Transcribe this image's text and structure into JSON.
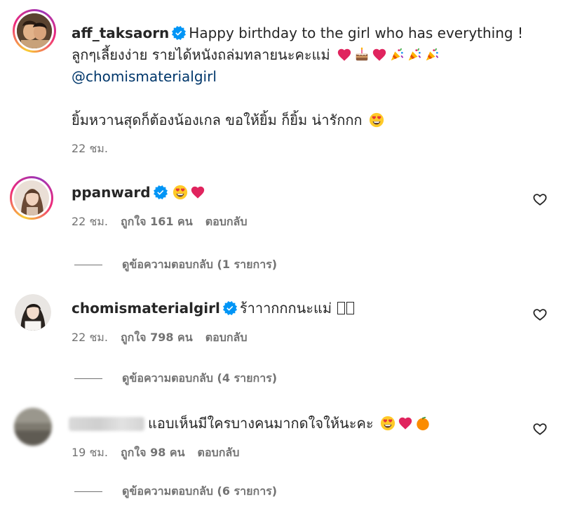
{
  "post": {
    "username": "aff_taksaorn",
    "caption_line1": "Happy birthday to the girl who has everything !",
    "caption_line2": "ลูกๆเลี้ยงง่าย รายได้หนังถล่มทลายนะคะแม่",
    "mention": "@chomismaterialgirl",
    "caption_line3": "ยิ้มหวานสุดก็ต้องน้องเกล ขอให้ยิ้ม ก็ยิ้ม น่ารักกก",
    "time": "22 ชม."
  },
  "comments": [
    {
      "username": "ppanward",
      "text": "",
      "time": "22 ชม.",
      "likes": "ถูกใจ 161 คน",
      "reply": "ตอบกลับ",
      "view_replies": "ดูข้อความตอบกลับ (1 รายการ)"
    },
    {
      "username": "chomismaterialgirl",
      "text": "ร้าาากกกนะแม่",
      "time": "22 ชม.",
      "likes": "ถูกใจ 798 คน",
      "reply": "ตอบกลับ",
      "view_replies": "ดูข้อความตอบกลับ (4 รายการ)"
    },
    {
      "username": "",
      "text": "แอบเห็นมีใครบางคนมากดใจให้นะคะ",
      "time": "19 ชม.",
      "likes": "ถูกใจ 98 คน",
      "reply": "ตอบกลับ",
      "view_replies": "ดูข้อความตอบกลับ (6 รายการ)"
    }
  ],
  "icons": [
    "verified-badge-icon",
    "heart-outline-icon",
    "red-heart-emoji",
    "cake-emoji",
    "party-popper-emoji",
    "heart-eyes-emoji",
    "tangerine-emoji"
  ],
  "colors": {
    "verified": "#0095f6",
    "mention": "#00376b",
    "meta": "#737373",
    "text": "#262626"
  }
}
